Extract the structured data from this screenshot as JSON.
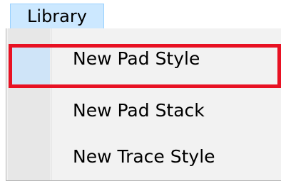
{
  "menubar": {
    "library_label": "Library"
  },
  "dropdown": {
    "items": [
      {
        "label": "New Pad Style",
        "highlighted": true
      },
      {
        "label": "New Pad Stack",
        "highlighted": false
      },
      {
        "label": "New Trace Style",
        "highlighted": false
      }
    ]
  },
  "colors": {
    "menu_title_bg": "#cce8ff",
    "highlight_border": "#e81123",
    "dropdown_bg": "#f2f2f2"
  }
}
